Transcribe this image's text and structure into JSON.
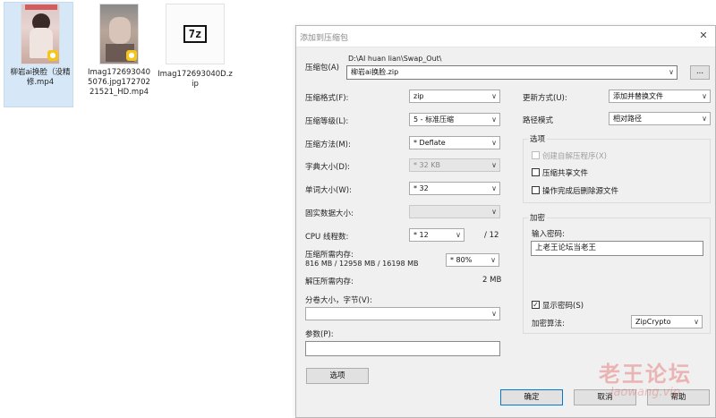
{
  "desktop": {
    "files": [
      {
        "name": "柳岩ai换脸（没精修.mp4",
        "badge": "●"
      },
      {
        "name": "Imag1726930405076.jpg17270221521_HD.mp4",
        "badge": "●"
      },
      {
        "name": "Imag172693040D.zip",
        "icon_text": "7z"
      }
    ]
  },
  "dialog": {
    "title": "添加到压缩包",
    "close": "✕",
    "archive": {
      "label": "压缩包(A)",
      "path": "D:\\AI huan lian\\Swap_Out\\",
      "value": "柳岩ai换脸.zip",
      "browse": "..."
    },
    "left": {
      "format": {
        "label": "压缩格式(F):",
        "value": "zip"
      },
      "level": {
        "label": "压缩等级(L):",
        "value": "5 - 标准压缩"
      },
      "method": {
        "label": "压缩方法(M):",
        "value": "* Deflate"
      },
      "dict": {
        "label": "字典大小(D):",
        "value": "* 32 KB"
      },
      "word": {
        "label": "单词大小(W):",
        "value": "* 32"
      },
      "solid": {
        "label": "固实数据大小:",
        "value": ""
      },
      "cpu": {
        "label": "CPU 线程数:",
        "value": "* 12",
        "total": "/ 12"
      },
      "mem_compress": {
        "label": "压缩所需内存:",
        "detail": "816 MB / 12958 MB / 16198 MB",
        "value": "* 80%"
      },
      "mem_decompress": {
        "label": "解压所需内存:",
        "value": "2 MB"
      },
      "split": {
        "label": "分卷大小，字节(V):",
        "value": ""
      },
      "params": {
        "label": "参数(P):",
        "value": ""
      },
      "options_button": "选项"
    },
    "right": {
      "update": {
        "label": "更新方式(U):",
        "value": "添加并替换文件"
      },
      "pathmode": {
        "label": "路径模式",
        "value": "相对路径"
      },
      "options": {
        "title": "选项",
        "sfx": "创建自解压程序(X)",
        "shared": "压缩共享文件",
        "delete": "操作完成后删除源文件"
      },
      "encryption": {
        "title": "加密",
        "pw_label": "输入密码:",
        "password": "上老王论坛当老王",
        "show_pw": "显示密码(S)",
        "method_label": "加密算法:",
        "method_value": "ZipCrypto"
      }
    },
    "buttons": {
      "ok": "确定",
      "cancel": "取消",
      "help": "帮助"
    }
  },
  "watermark": {
    "line1": "老王论坛",
    "line2": "laowang.vip"
  },
  "icons": {
    "dropdown": "∨",
    "check": "✓"
  }
}
